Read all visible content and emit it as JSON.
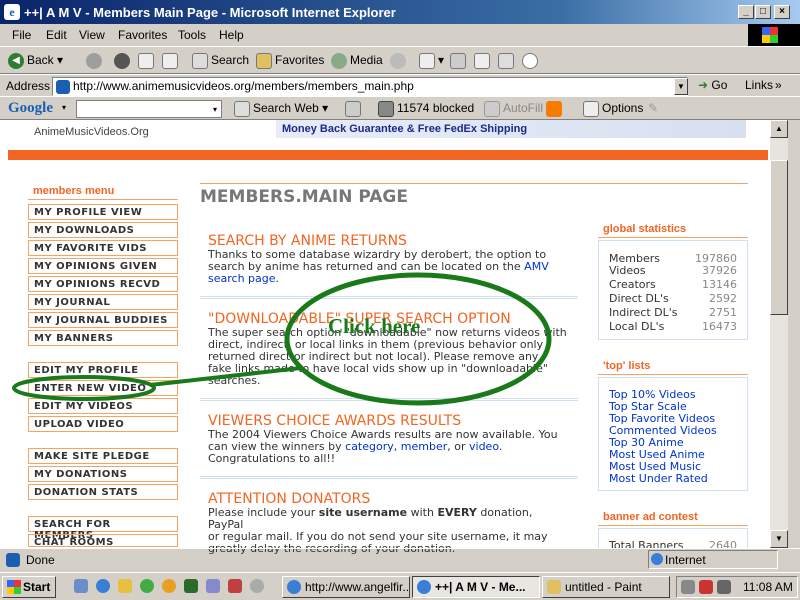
{
  "window": {
    "title": "++| A M V - Members Main Page - Microsoft Internet Explorer",
    "ie_icon": "e"
  },
  "menubar": [
    "File",
    "Edit",
    "View",
    "Favorites",
    "Tools",
    "Help"
  ],
  "toolbar": {
    "back": "Back",
    "search": "Search",
    "favorites": "Favorites",
    "media": "Media"
  },
  "address": {
    "label": "Address",
    "url": "http://www.animemusicvideos.org/members/members_main.php",
    "go": "Go",
    "links": "Links"
  },
  "googlebar": {
    "google": "Google",
    "search_web": "Search Web",
    "blocked": "11574 blocked",
    "autofill": "AutoFill",
    "options": "Options"
  },
  "banner": {
    "site": "AnimeMusicVideos.Org",
    "ad": "Money Back Guarantee & Free FedEx Shipping"
  },
  "sidebar": {
    "header": "members menu",
    "group1": [
      "MY PROFILE VIEW",
      "MY DOWNLOADS",
      "MY FAVORITE VIDS",
      "MY OPINIONS GIVEN",
      "MY OPINIONS RECVD",
      "MY JOURNAL",
      "MY JOURNAL BUDDIES",
      "MY BANNERS"
    ],
    "group2": [
      "EDIT MY PROFILE",
      "ENTER NEW VIDEO",
      "EDIT MY VIDEOS",
      "UPLOAD VIDEO"
    ],
    "group3": [
      "MAKE SITE PLEDGE",
      "MY DONATIONS",
      "DONATION STATS"
    ],
    "group4": [
      "SEARCH FOR MEMBERS",
      "CHAT ROOMS"
    ]
  },
  "main": {
    "title": "MEMBERS.MAIN PAGE",
    "n1": {
      "title": "SEARCH BY ANIME RETURNS",
      "l1": "Thanks to some database wizardry by derobert, the option to",
      "l2": "search by anime has returned and can be located on the ",
      "link": "AMV search page",
      "l3": "search page",
      "end": "."
    },
    "n2": {
      "title": "\"DOWNLOADABLE\" SUPER SEARCH OPTION",
      "l1": "The super search option \"downloadable\" now returns videos with",
      "l2": "direct, indirect, or local links in them (previous behavior only",
      "l3": "returned direct or indirect but not local). Please remove any",
      "l4": "fake links made to have local vids show up in \"downloadable\"",
      "l5": "searches."
    },
    "n3": {
      "title": "VIEWERS CHOICE AWARDS RESULTS",
      "l1": "The 2004 Viewers Choice Awards results are now available. You",
      "l2a": "can view the winners by ",
      "category": "category",
      "member": "member",
      "video": "video",
      "l3": "Congratulations to all!!"
    },
    "n4": {
      "title": "ATTENTION DONATORS",
      "l1a": "Please include your ",
      "bold1": "site username",
      "l1b": " with ",
      "bold2": "EVERY",
      "l1c": " donation, PayPal",
      "l2": "or regular mail. If you do not send your site username, it may",
      "l3": "greatly delay the recording of your donation."
    }
  },
  "stats": {
    "header": "global statistics",
    "rows": [
      {
        "k": "Members",
        "v": "197860"
      },
      {
        "k": "Videos",
        "v": "37926"
      },
      {
        "k": "Creators",
        "v": "13146"
      },
      {
        "k": "Direct DL's",
        "v": "2592"
      },
      {
        "k": "Indirect DL's",
        "v": "2751"
      },
      {
        "k": "Local DL's",
        "v": "16473"
      }
    ]
  },
  "toplists": {
    "header": "'top' lists",
    "items": [
      "Top 10% Videos",
      "Top Star Scale",
      "Top Favorite Videos",
      "Commented Videos",
      "Top 30 Anime",
      "Most Used Anime",
      "Most Used Music",
      "Most Under Rated"
    ]
  },
  "banner_contest": {
    "header": "banner ad contest",
    "row": "Total Banners",
    "val": "2640"
  },
  "annotation": {
    "text": "Click here"
  },
  "status": {
    "text": "Done",
    "zone": "Internet"
  },
  "taskbar": {
    "start": "Start",
    "tasks": [
      "http://www.angelfir...",
      "++| A M V - Me...",
      "untitled - Paint"
    ],
    "clock": "11:08 AM"
  },
  "colors": {
    "accent": "#f26522",
    "link": "#0033cc",
    "annotation": "#1a7a1a"
  }
}
